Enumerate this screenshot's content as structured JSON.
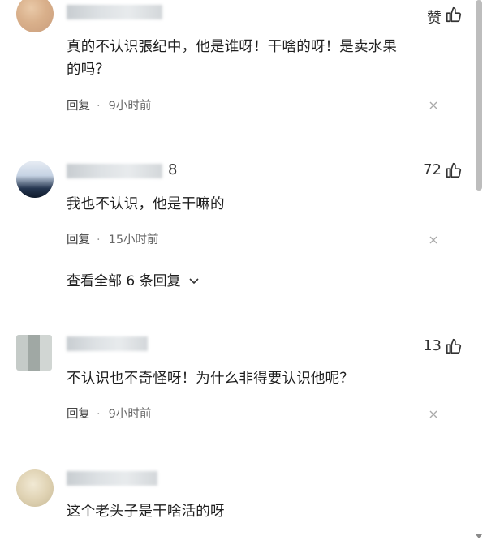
{
  "comments": [
    {
      "username_suffix": "",
      "likes": "赞",
      "text_line1": "真的不认识張纪中，他是谁呀！干啥的呀！是卖水果",
      "text_line2": "的吗？",
      "reply_label": "回复",
      "separator": "·",
      "time": "9小时前"
    },
    {
      "username_suffix": "8",
      "likes": "72",
      "text_line1": "我也不认识，他是干嘛的",
      "reply_label": "回复",
      "separator": "·",
      "time": "15小时前",
      "view_replies": "查看全部 6 条回复"
    },
    {
      "username_suffix": "",
      "likes": "13",
      "text_line1": "不认识也不奇怪呀！为什么非得要认识他呢？",
      "reply_label": "回复",
      "separator": "·",
      "time": "9小时前"
    },
    {
      "username_suffix": "",
      "likes": "",
      "text_line1": "这个老头子是干啥活的呀"
    }
  ],
  "icons": {
    "like": "thumbs-up-icon",
    "close": "close-icon",
    "expand": "chevron-down-icon"
  },
  "colors": {
    "text": "#1f1f1f",
    "meta": "#666666",
    "scrollbar": "#bdbdbd"
  }
}
